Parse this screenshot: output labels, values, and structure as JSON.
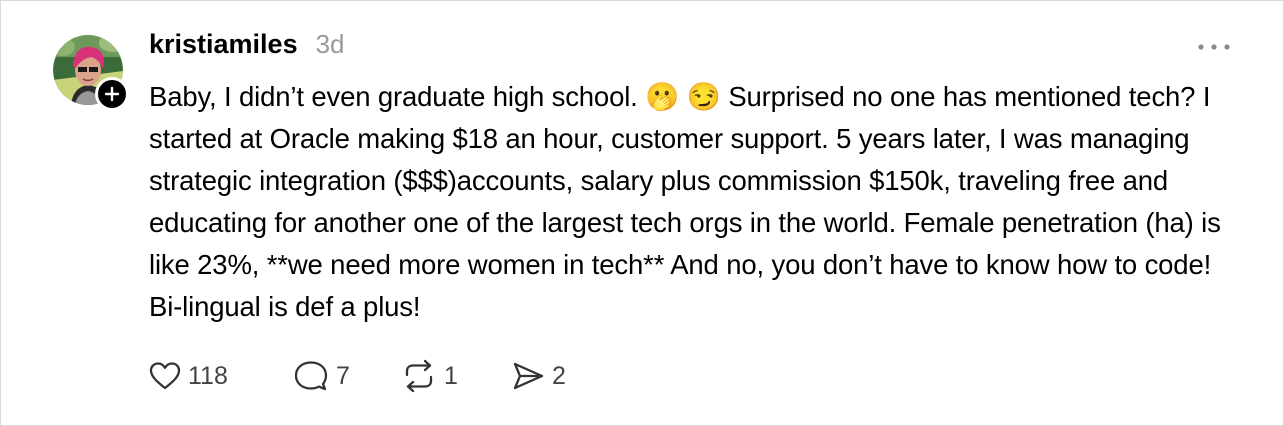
{
  "post": {
    "username": "kristiamiles",
    "time": "3d",
    "text": "Baby, I didn’t even graduate high school. 🫢 😏 Surprised no one has mentioned tech? I started at Oracle making $18 an hour, customer support. 5 years later, I was managing strategic integration ($$$)accounts, salary plus commission $150k, traveling free and educating for another one of the largest tech orgs in the world. Female penetration (ha) is like 23%, **we need more women in tech** And no, you don’t have to know how to code! Bi-lingual is def a plus!",
    "stats": {
      "likes": "118",
      "replies": "7",
      "reposts": "1",
      "shares": "2"
    }
  },
  "colors": {
    "text": "#000000",
    "muted": "#999999",
    "count": "#444444",
    "border": "#d9d9d9",
    "avatar_hair": "#d8327a"
  },
  "icons": {
    "more": "more-horizontal-icon",
    "follow": "plus-icon",
    "like": "heart-icon",
    "reply": "comment-icon",
    "repost": "repost-icon",
    "share": "send-icon"
  }
}
